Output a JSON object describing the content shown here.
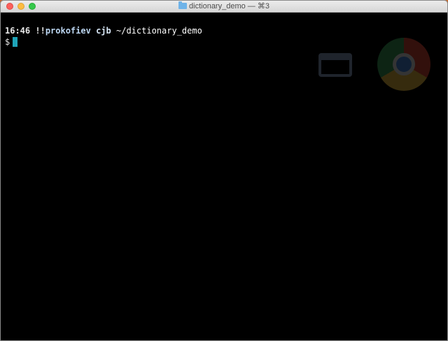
{
  "window": {
    "title": "dictionary_demo — ⌘3"
  },
  "prompt": {
    "time": "16:46",
    "marker": "!!",
    "user": "prokofiev",
    "host": "cjb",
    "path": "~/dictionary_demo",
    "symbol": "$"
  },
  "colors": {
    "terminal_background": "#000000",
    "cursor": "#1fa4b8",
    "username": "#bcd6f2"
  },
  "icons": {
    "title": "folder-icon",
    "background_left": "window-icon",
    "background_right": "chrome-icon"
  }
}
